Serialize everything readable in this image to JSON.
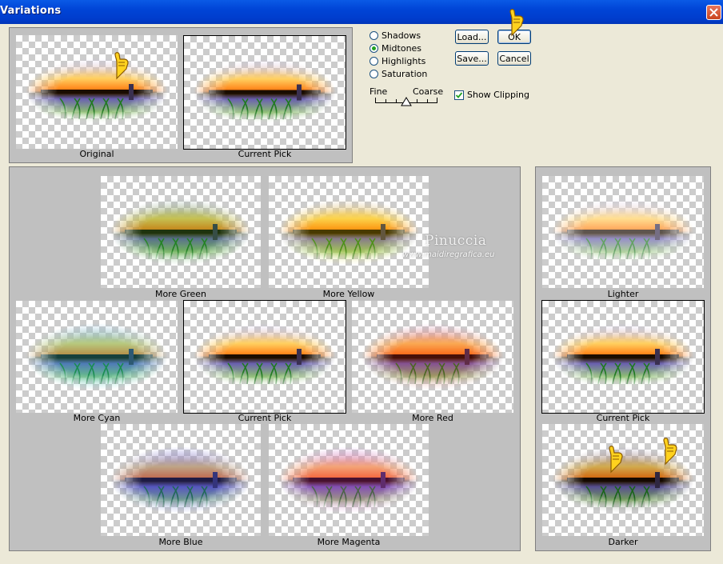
{
  "window": {
    "title": "Variations",
    "close_icon": "close-icon"
  },
  "top_thumbs": [
    {
      "label": "Original",
      "variant": "original"
    },
    {
      "label": "Current Pick",
      "variant": "current"
    }
  ],
  "tone_options": [
    {
      "label": "Shadows",
      "selected": false
    },
    {
      "label": "Midtones",
      "selected": true
    },
    {
      "label": "Highlights",
      "selected": false
    },
    {
      "label": "Saturation",
      "selected": false
    }
  ],
  "buttons": {
    "load": "Load...",
    "ok": "OK",
    "save": "Save...",
    "cancel": "Cancel"
  },
  "slider": {
    "fine_label": "Fine",
    "coarse_label": "Coarse",
    "position_fraction": 0.5
  },
  "show_clipping": {
    "label": "Show Clipping",
    "checked": true
  },
  "color_variations": [
    {
      "label": "More Green",
      "variant": "green"
    },
    {
      "label": "More Yellow",
      "variant": "yellow"
    },
    {
      "label": "More Cyan",
      "variant": "cyan"
    },
    {
      "label": "Current Pick",
      "variant": "current"
    },
    {
      "label": "More Red",
      "variant": "red"
    },
    {
      "label": "More Blue",
      "variant": "blue"
    },
    {
      "label": "More Magenta",
      "variant": "magenta"
    }
  ],
  "brightness_variations": [
    {
      "label": "Lighter",
      "variant": "lighter"
    },
    {
      "label": "Current Pick",
      "variant": "current"
    },
    {
      "label": "Darker",
      "variant": "darker"
    }
  ],
  "watermark": {
    "name": "Pinuccia",
    "site": "www.maidiregrafica.eu"
  },
  "colors": {
    "titlebar": "#0044d6",
    "panel": "#c0c0c0",
    "dialog": "#ece9d8"
  }
}
